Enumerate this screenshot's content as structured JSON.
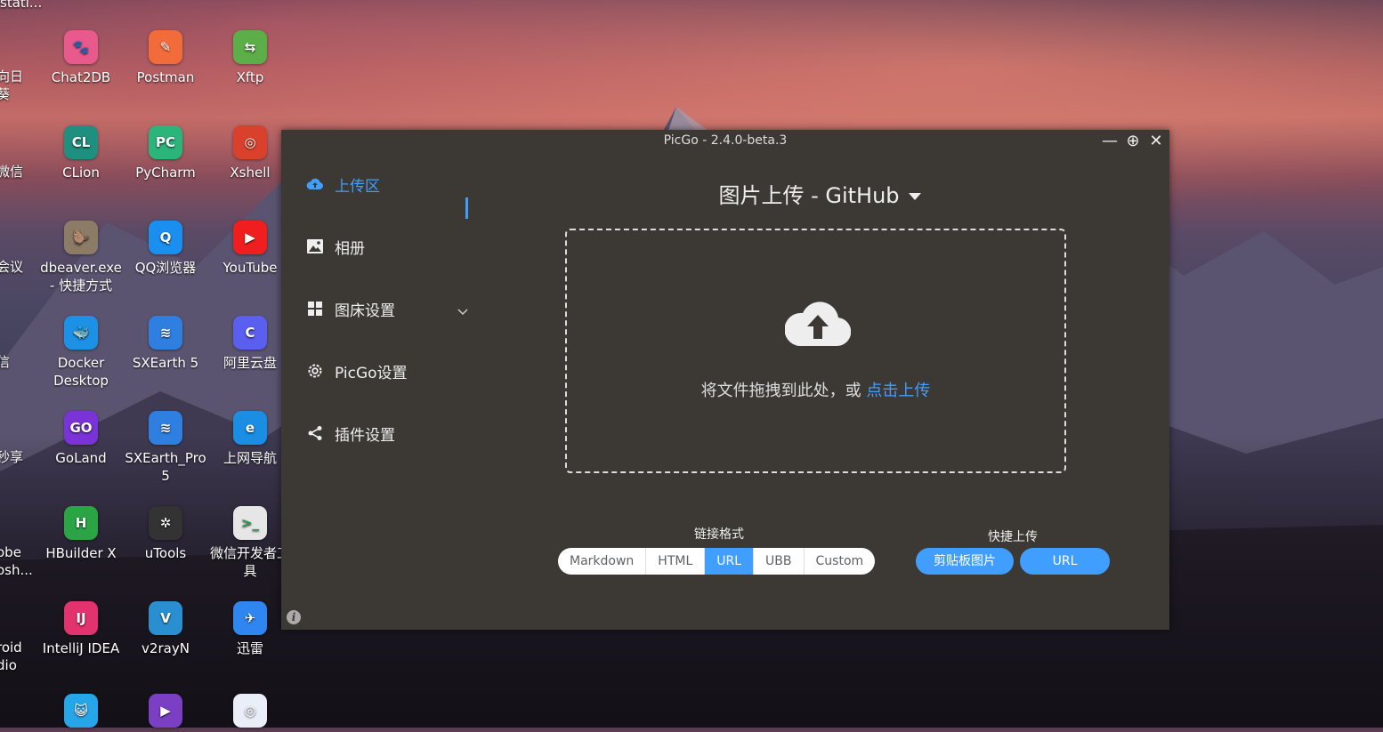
{
  "desktop": {
    "icons": [
      {
        "label": "Chat2DB",
        "glyph": "🐾",
        "color": "#e85a8c"
      },
      {
        "label": "Postman",
        "glyph": "✎",
        "color": "#f26b3a"
      },
      {
        "label": "Xftp",
        "glyph": "⇆",
        "color": "#5cae48"
      },
      {
        "label": "CLion",
        "glyph": "CL",
        "color": "#1f8f7f"
      },
      {
        "label": "PyCharm",
        "glyph": "PC",
        "color": "#2bb57a"
      },
      {
        "label": "Xshell",
        "glyph": "◎",
        "color": "#d9412c"
      },
      {
        "label": "dbeaver.exe - 快捷方式",
        "glyph": "🦫",
        "color": "#8c7b67"
      },
      {
        "label": "QQ浏览器",
        "glyph": "Q",
        "color": "#1a8ff0"
      },
      {
        "label": "YouTube",
        "glyph": "▶",
        "color": "#f01e1e"
      },
      {
        "label": "Docker Desktop",
        "glyph": "🐳",
        "color": "#1d91e6"
      },
      {
        "label": "SXEarth 5",
        "glyph": "≋",
        "color": "#2f7fe0"
      },
      {
        "label": "阿里云盘",
        "glyph": "C",
        "color": "#5b5ff0"
      },
      {
        "label": "GoLand",
        "glyph": "GO",
        "color": "#7a33d6"
      },
      {
        "label": "SXEarth_Pro 5",
        "glyph": "≋",
        "color": "#2f7fe0"
      },
      {
        "label": "上网导航",
        "glyph": "e",
        "color": "#1b8de3"
      },
      {
        "label": "HBuilder X",
        "glyph": "H",
        "color": "#2aa444"
      },
      {
        "label": "uTools",
        "glyph": "✲",
        "color": "#333333"
      },
      {
        "label": "微信开发者工具",
        "glyph": ">_",
        "color": "#e6e6e6"
      },
      {
        "label": "IntelliJ IDEA",
        "glyph": "IJ",
        "color": "#e2336e"
      },
      {
        "label": "v2rayN",
        "glyph": "V",
        "color": "#2a8fd0"
      },
      {
        "label": "迅雷",
        "glyph": "✈",
        "color": "#2f86f0"
      }
    ],
    "left_partials": [
      "向日葵",
      "微信",
      "会议",
      "信",
      "秒享",
      "obe osh...",
      "roid dio"
    ],
    "bottom_glyphs": [
      "😺",
      "▶",
      "◎"
    ],
    "top_partial": "stati..."
  },
  "window": {
    "title": "PicGo - 2.4.0-beta.3",
    "controls": {
      "minimize": "—",
      "maximize": "⊕",
      "close": "✕"
    },
    "nav": [
      {
        "label": "上传区",
        "icon": "cloud-upload-icon",
        "active": true
      },
      {
        "label": "相册",
        "icon": "image-icon",
        "active": false
      },
      {
        "label": "图床设置",
        "icon": "grid-icon",
        "active": false
      },
      {
        "label": "PicGo设置",
        "icon": "gear-icon",
        "active": false
      },
      {
        "label": "插件设置",
        "icon": "share-icon",
        "active": false
      }
    ],
    "upload_title": "图片上传 - GitHub",
    "drop_text": "将文件拖拽到此处，或 ",
    "drop_link": "点击上传",
    "link_format_label": "链接格式",
    "formats": [
      "Markdown",
      "HTML",
      "URL",
      "UBB",
      "Custom"
    ],
    "selected_format": "URL",
    "quick_upload_label": "快捷上传",
    "quick_buttons": [
      "剪贴板图片",
      "URL"
    ],
    "info_glyph": "i"
  },
  "colors": {
    "accent": "#409eff",
    "window_bg": "#3c3935"
  }
}
